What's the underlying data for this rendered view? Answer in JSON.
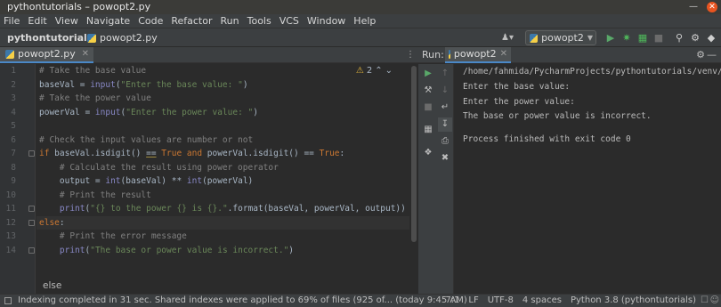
{
  "window": {
    "title": "pythontutorials – powopt2.py"
  },
  "menu": [
    "File",
    "Edit",
    "View",
    "Navigate",
    "Code",
    "Refactor",
    "Run",
    "Tools",
    "VCS",
    "Window",
    "Help"
  ],
  "nav": {
    "project": "pythontutorials",
    "file": "powopt2.py",
    "run_config": "powopt2"
  },
  "editor": {
    "tab": "powopt2.py",
    "warning_count": "2",
    "line_numbers": [
      "1",
      "2",
      "3",
      "4",
      "5",
      "6",
      "7",
      "8",
      "9",
      "10",
      "11",
      "12",
      "13",
      "14"
    ],
    "lines": {
      "l1": "# Take the base value",
      "l2a": "baseVal = ",
      "l2b": "input",
      "l2c": "(",
      "l2d": "\"Enter the base value: \"",
      "l2e": ")",
      "l3": "# Take the power value",
      "l4a": "powerVal = ",
      "l4b": "input",
      "l4c": "(",
      "l4d": "\"Enter the power value: \"",
      "l4e": ")",
      "l6": "# Check the input values are number or not",
      "l7a": "if",
      "l7b": " baseVal.isdigit() ",
      "l7c": "==",
      "l7d": " True",
      "l7e": " and",
      "l7f": " powerVal.isdigit() == ",
      "l7g": "True",
      "l7h": ":",
      "l8": "    # Calculate the result using power operator",
      "l9a": "    output = ",
      "l9b": "int",
      "l9c": "(baseVal) ** ",
      "l9d": "int",
      "l9e": "(powerVal)",
      "l10": "    # Print the result",
      "l11a": "    ",
      "l11b": "print",
      "l11c": "(",
      "l11d": "\"{} to the power {} is {}.\"",
      "l11e": ".format(baseVal, powerVal, output))",
      "l12a": "else",
      "l12b": ":",
      "l13": "    # Print the error message",
      "l14a": "    ",
      "l14b": "print",
      "l14c": "(",
      "l14d": "\"The base or power value is incorrect.\"",
      "l14e": ")"
    },
    "breadcrumb": "else"
  },
  "run_panel": {
    "label": "Run:",
    "tab": "powopt2",
    "output": [
      "/home/fahmida/PycharmProjects/pythontutorials/venv/b",
      "Enter the base value: ",
      "Enter the power value: ",
      "The base or power value is incorrect.",
      "",
      "Process finished with exit code 0"
    ]
  },
  "status": {
    "message": "Indexing completed in 31 sec. Shared indexes were applied to 69% of files (925 of... (today 9:45 AM)",
    "position": "7:1",
    "line_sep": "LF",
    "encoding": "UTF-8",
    "indent": "4 spaces",
    "interpreter": "Python 3.8 (pythontutorials)"
  },
  "colors": {
    "accent": "#4a88c7",
    "background": "#2b2b2b",
    "panel": "#3c3f41",
    "run_green": "#59a869",
    "debug_green": "#4fb85b"
  }
}
